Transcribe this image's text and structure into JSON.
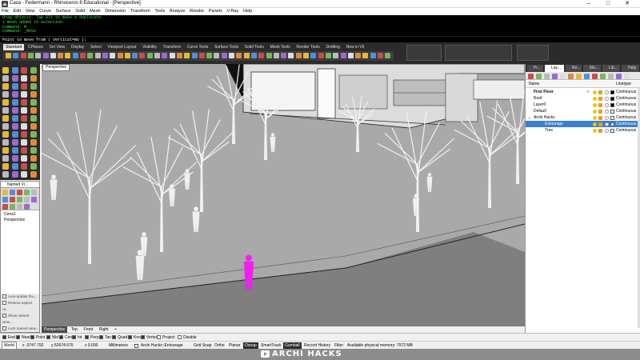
{
  "window": {
    "title": "Casa - Federmann - Rhinoceros 6 Educational - [Perspective]",
    "min": "–",
    "max": "□",
    "close": "✕"
  },
  "menu": [
    "File",
    "Edit",
    "View",
    "Curve",
    "Surface",
    "Solid",
    "Mesh",
    "Dimension",
    "Transform",
    "Tools",
    "Analyze",
    "Render",
    "Panels",
    "V-Ray",
    "Help"
  ],
  "command": {
    "history": [
      "Drag objects. Tap Alt to make a duplicate",
      "1 mesh added to selection.",
      "Command: M",
      "Command: _Move"
    ],
    "prompt": "Point to move from ( Vertical=No ):"
  },
  "toolbar": {
    "tabs": [
      "Standard",
      "CPlanes",
      "Set View",
      "Display",
      "Select",
      "Viewport Layout",
      "Visibility",
      "Transform",
      "Curve Tools",
      "Surface Tools",
      "Solid Tools",
      "Mesh Tools",
      "Render Tools",
      "Drafting",
      "New in V6"
    ]
  },
  "named_views": {
    "title": "Named Vi...",
    "items": [
      "Cena1",
      "Perspective"
    ],
    "options": [
      "Auto-update thu...",
      "Restore aspect ra...",
      "Show named view...",
      "Lock named view...",
      "Auto-select name..."
    ]
  },
  "viewport": {
    "label": "Perspective",
    "tabs": [
      "Perspective",
      "Top",
      "Front",
      "Right"
    ],
    "add_tab": "+",
    "colors": {
      "ground": "#a7a7a7",
      "road": "#7e7e7e",
      "selected": "#f21ff2"
    }
  },
  "layers_panel": {
    "tabs": [
      "Pr...",
      "Lay...",
      "Re...",
      "Ma...",
      "Lib...",
      "Help"
    ],
    "headers": {
      "name": "Name",
      "linetype": "Linetype"
    },
    "rows": [
      {
        "name": "First Floor",
        "current": "✓",
        "linetype": "Continuous",
        "color": "#000000",
        "bold": true
      },
      {
        "name": "Roof",
        "current": "",
        "linetype": "Continuous",
        "color": "#000000"
      },
      {
        "name": "Layer0",
        "current": "",
        "linetype": "Continuous",
        "color": "#000000"
      },
      {
        "name": "Default",
        "current": "",
        "linetype": "Continuous",
        "color": "#ffffff"
      },
      {
        "name": "Archi Hacks",
        "current": "",
        "linetype": "Continuous",
        "color": "#ffffff",
        "expander": "⌄"
      },
      {
        "name": "Entourage",
        "current": "",
        "linetype": "Continuous",
        "color": "#ffffff",
        "selected": true
      },
      {
        "name": "Tree",
        "current": "",
        "linetype": "Continuous",
        "color": "#ffffff"
      }
    ]
  },
  "osnap": [
    {
      "label": "End",
      "on": true
    },
    {
      "label": "Near",
      "on": true
    },
    {
      "label": "Point",
      "on": true
    },
    {
      "label": "Mid",
      "on": true
    },
    {
      "label": "Cen",
      "on": true
    },
    {
      "label": "Int",
      "on": true
    },
    {
      "label": "Perp",
      "on": true
    },
    {
      "label": "Tan",
      "on": true
    },
    {
      "label": "Quad",
      "on": true
    },
    {
      "label": "Knot",
      "on": true
    },
    {
      "label": "Vertex",
      "on": true
    },
    {
      "label": "Project",
      "on": false
    },
    {
      "label": "Disable",
      "on": false
    }
  ],
  "status": {
    "cplane": "World",
    "x": "x -3747.792",
    "y": "y 52674.670",
    "z": "z 0.000",
    "units": "Millimeters",
    "layer": "Archi Hacks::Entourage",
    "toggles": [
      "Grid Snap",
      "Ortho",
      "Planar",
      "Osnap",
      "SmartTrack",
      "Gumball",
      "Record History",
      "Filter"
    ],
    "active_toggles": [
      "Osnap",
      "Gumball"
    ],
    "memory": "Available physical memory: 7972 MB"
  },
  "brand": "ARCHI HACKS"
}
